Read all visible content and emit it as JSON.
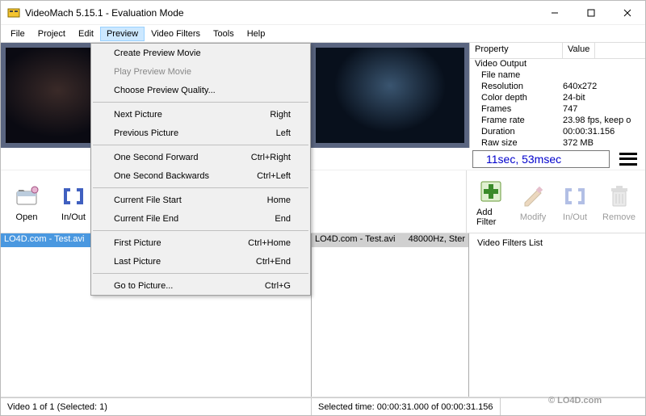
{
  "title": "VideoMach 5.15.1 - Evaluation Mode",
  "menubar": [
    "File",
    "Project",
    "Edit",
    "Preview",
    "Video Filters",
    "Tools",
    "Help"
  ],
  "preview_menu": [
    {
      "label": "Create Preview Movie",
      "shortcut": ""
    },
    {
      "label": "Play Preview Movie",
      "shortcut": "",
      "disabled": true
    },
    {
      "label": "Choose Preview Quality...",
      "shortcut": ""
    },
    {
      "sep": true
    },
    {
      "label": "Next Picture",
      "shortcut": "Right"
    },
    {
      "label": "Previous Picture",
      "shortcut": "Left"
    },
    {
      "sep": true
    },
    {
      "label": "One Second Forward",
      "shortcut": "Ctrl+Right"
    },
    {
      "label": "One Second Backwards",
      "shortcut": "Ctrl+Left"
    },
    {
      "sep": true
    },
    {
      "label": "Current File Start",
      "shortcut": "Home"
    },
    {
      "label": "Current File End",
      "shortcut": "End"
    },
    {
      "sep": true
    },
    {
      "label": "First Picture",
      "shortcut": "Ctrl+Home"
    },
    {
      "label": "Last Picture",
      "shortcut": "Ctrl+End"
    },
    {
      "sep": true
    },
    {
      "label": "Go to Picture...",
      "shortcut": "Ctrl+G"
    }
  ],
  "props": {
    "header_prop": "Property",
    "header_val": "Value",
    "group": "Video Output",
    "rows": [
      {
        "name": "File name",
        "value": ""
      },
      {
        "name": "Resolution",
        "value": "640x272"
      },
      {
        "name": "Color depth",
        "value": "24-bit"
      },
      {
        "name": "Frames",
        "value": "747"
      },
      {
        "name": "Frame rate",
        "value": "23.98 fps, keep o"
      },
      {
        "name": "Duration",
        "value": "00:00:31.156"
      },
      {
        "name": "Raw size",
        "value": "372 MB"
      }
    ]
  },
  "time_display": "11sec, 53msec",
  "tools_left": [
    {
      "name": "open",
      "label": "Open"
    },
    {
      "name": "inout",
      "label": "In/Out"
    }
  ],
  "tools_right": [
    {
      "name": "add-filter",
      "label": "Add Filter"
    },
    {
      "name": "modify",
      "label": "Modify",
      "disabled": true
    },
    {
      "name": "inout2",
      "label": "In/Out",
      "disabled": true
    },
    {
      "name": "remove",
      "label": "Remove",
      "disabled": true
    }
  ],
  "file_list_left": {
    "text": "LO4D.com - Test.avi"
  },
  "file_list_mid": {
    "text_left": "LO4D.com - Test.avi",
    "text_right": "48000Hz, Ster"
  },
  "filters_title": "Video Filters List",
  "status": {
    "left": "Video 1 of 1 (Selected: 1)",
    "right": "Selected time:  00:00:31.000  of  00:00:31.156"
  },
  "watermark": "© LO4D.com"
}
